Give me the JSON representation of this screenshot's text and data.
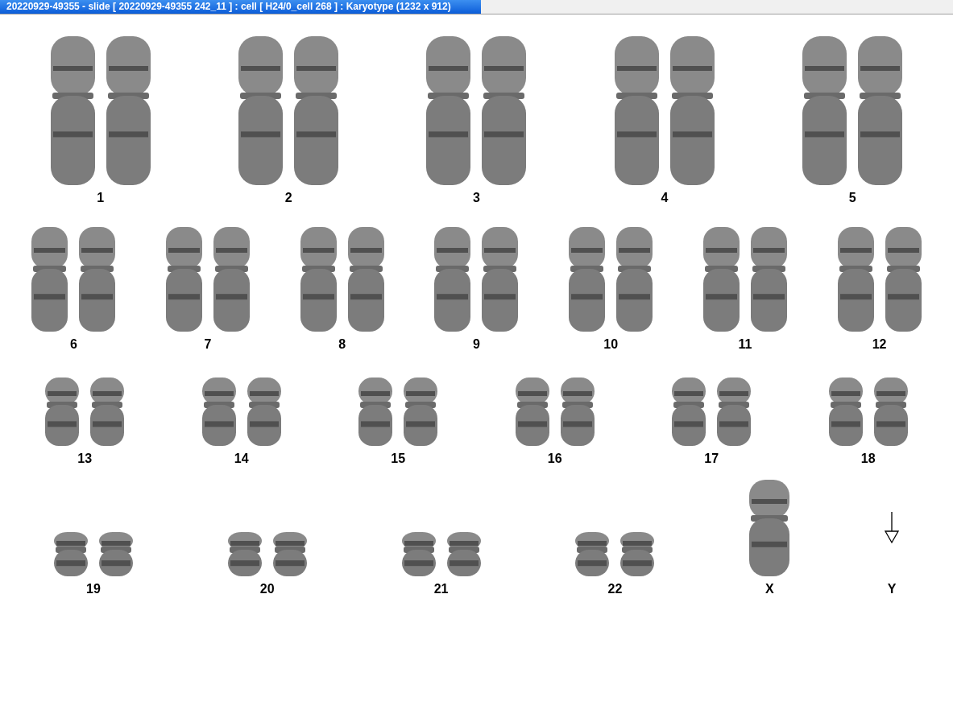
{
  "window": {
    "title": "20220929-49355 - slide [ 20220929-49355 242_11 ] : cell [ H24/0_cell 268 ] : Karyotype  (1232 x 912)"
  },
  "rows": [
    {
      "items": [
        {
          "label": "1",
          "kind": "pair"
        },
        {
          "label": "2",
          "kind": "pair"
        },
        {
          "label": "3",
          "kind": "pair"
        },
        {
          "label": "4",
          "kind": "pair"
        },
        {
          "label": "5",
          "kind": "pair"
        }
      ]
    },
    {
      "items": [
        {
          "label": "6",
          "kind": "pair"
        },
        {
          "label": "7",
          "kind": "pair"
        },
        {
          "label": "8",
          "kind": "pair"
        },
        {
          "label": "9",
          "kind": "pair"
        },
        {
          "label": "10",
          "kind": "pair"
        },
        {
          "label": "11",
          "kind": "pair"
        },
        {
          "label": "12",
          "kind": "pair"
        }
      ]
    },
    {
      "items": [
        {
          "label": "13",
          "kind": "pair"
        },
        {
          "label": "14",
          "kind": "pair"
        },
        {
          "label": "15",
          "kind": "pair"
        },
        {
          "label": "16",
          "kind": "pair"
        },
        {
          "label": "17",
          "kind": "pair"
        },
        {
          "label": "18",
          "kind": "pair"
        }
      ]
    },
    {
      "items": [
        {
          "label": "19",
          "kind": "pair"
        },
        {
          "label": "20",
          "kind": "pair"
        },
        {
          "label": "21",
          "kind": "pair"
        },
        {
          "label": "22",
          "kind": "pair"
        },
        {
          "label": "X",
          "kind": "single"
        },
        {
          "label": "Y",
          "kind": "marker"
        }
      ]
    }
  ]
}
